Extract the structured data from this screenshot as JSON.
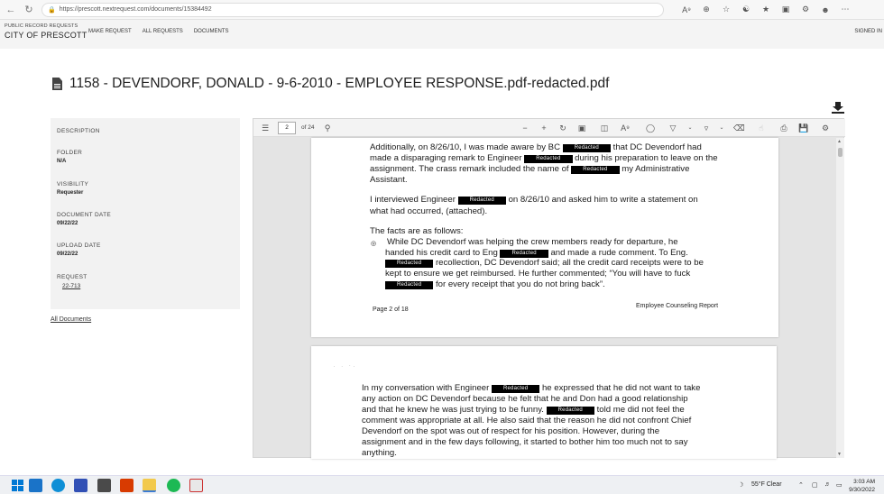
{
  "browser": {
    "url": "https://prescott.nextrequest.com/documents/15384492",
    "icons": [
      "read-aloud-icon",
      "zoom-icon",
      "favorite-add-icon",
      "refresh-icon",
      "favorites-icon",
      "collections-icon",
      "extension-icon",
      "profile-icon",
      "menu-icon"
    ]
  },
  "site": {
    "subtitle": "PUBLIC RECORD REQUESTS",
    "title": "CITY OF PRESCOTT",
    "nav": [
      "MAKE REQUEST",
      "ALL REQUESTS",
      "DOCUMENTS"
    ],
    "signin": "SIGNED IN"
  },
  "document": {
    "title": "1158 - DEVENDORF, DONALD - 9-6-2010 - EMPLOYEE RESPONSE.pdf-redacted.pdf"
  },
  "sidebar": {
    "description_label": "DESCRIPTION",
    "folder_label": "FOLDER",
    "folder_value": "N/A",
    "visibility_label": "VISIBILITY",
    "visibility_value": "Requester",
    "doc_date_label": "DOCUMENT DATE",
    "doc_date_value": "09/22/22",
    "upload_date_label": "UPLOAD DATE",
    "upload_date_value": "09/22/22",
    "request_label": "REQUEST",
    "request_value": "22-713",
    "all_documents": "All Documents"
  },
  "viewer": {
    "page_current": "2",
    "page_total": "of 24"
  },
  "pdf": {
    "redacted": "Redacted",
    "page1": {
      "l1a": "Additionally, on 8/26/10, I was made aware by BC",
      "l1b": "that DC Devendorf had",
      "l2a": "made a disparaging remark to Engineer",
      "l2b": "during his preparation to leave on the",
      "l3a": "assignment. The crass remark included the name of",
      "l3b": "my Administrative",
      "l4": "Assistant.",
      "l5a": "I interviewed Engineer",
      "l5b": "on 8/26/10 and asked him to write a statement on",
      "l6": "what had occurred, (attached).",
      "l7": "The facts are as follows:",
      "l8": "While DC Devendorf was helping the crew members ready for departure, he",
      "l9a": "handed his credit card to Eng",
      "l9b": "and made a rude comment. To Eng.",
      "l10b": "recollection, DC Devendorf said; all the credit card receipts were to be",
      "l11": "kept to ensure we get reimbursed. He further commented; “You will have to fuck",
      "l12b": "for every receipt that you do not bring back”.",
      "footer_left": "Page 2 of 18",
      "footer_right": "Employee Counseling Report"
    },
    "page2": {
      "l1a": "In my conversation with Engineer",
      "l1b": "he expressed that he did not want to take",
      "l2": "any action on DC Devendorf because he felt that he and Don had a good relationship",
      "l3a": "and that he knew he was just trying to be funny.",
      "l3b": "told me did not feel the",
      "l4": "comment was appropriate at all. He also said that the reason he did not confront Chief",
      "l5": "Devendorf on the spot was out of respect for his position. However, during the",
      "l6": "assignment and in the few days following, it started to bother him too much not to say",
      "l7": "anything."
    }
  },
  "taskbar": {
    "weather": "55°F  Clear",
    "time": "3:03 AM",
    "date": "9/30/2022"
  }
}
